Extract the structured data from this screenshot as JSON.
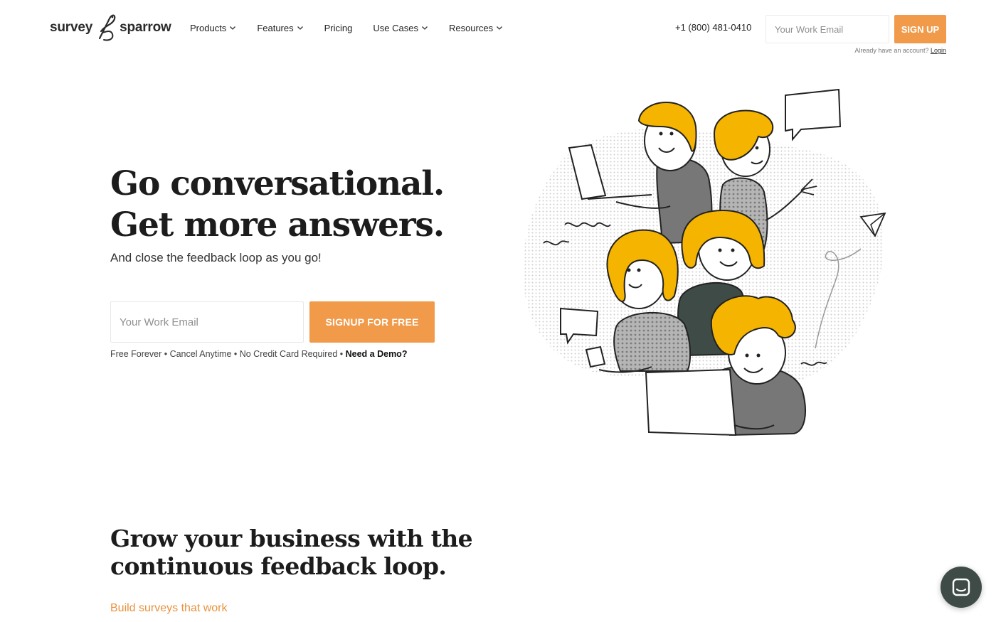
{
  "brand": {
    "name_left": "survey",
    "name_right": "sparrow",
    "accent": "#f09a4a",
    "dark": "#3f4b47"
  },
  "nav": {
    "items": [
      {
        "label": "Products",
        "has_dropdown": true
      },
      {
        "label": "Features",
        "has_dropdown": true
      },
      {
        "label": "Pricing",
        "has_dropdown": false
      },
      {
        "label": "Use Cases",
        "has_dropdown": true
      },
      {
        "label": "Resources",
        "has_dropdown": true
      }
    ],
    "phone": "+1 (800) 481-0410",
    "email_placeholder": "Your Work Email",
    "signup_label": "SIGN UP",
    "already_text": "Already have an account?",
    "login_label": "Login"
  },
  "hero": {
    "title_line1": "Go conversational.",
    "title_line2": "Get more answers.",
    "subtitle": "And close the feedback loop as you go!",
    "email_placeholder": "Your Work Email",
    "signup_label": "SIGNUP FOR FREE",
    "notes": "Free Forever • Cancel Anytime • No Credit Card Required • ",
    "demo_label": "Need a Demo?"
  },
  "section2": {
    "title_line1": "Grow your business with the",
    "title_line2": "continuous feedback loop.",
    "link": "Build surveys that work"
  },
  "icons": {
    "chevron": "chevron-down-icon",
    "chat": "chat-icon",
    "paper_plane": "paper-plane-icon"
  }
}
